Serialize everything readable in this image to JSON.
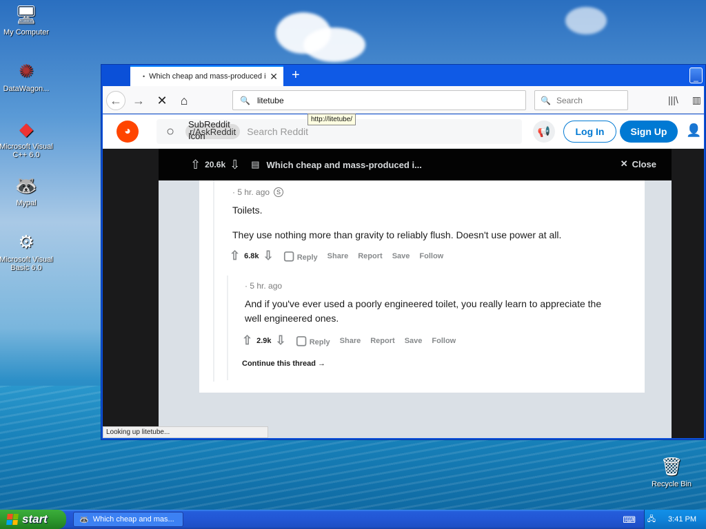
{
  "desktop": {
    "icons": [
      {
        "label": "My Computer",
        "icon": "computer-icon"
      },
      {
        "label": "DataWagon...",
        "icon": "datawagon-icon"
      },
      {
        "label": "Microsoft Visual C++ 6.0",
        "icon": "visual-cpp-icon"
      },
      {
        "label": "Mypal",
        "icon": "mypal-icon"
      },
      {
        "label": "Microsoft Visual Basic 6.0",
        "icon": "visual-basic-icon"
      },
      {
        "label": "Recycle Bin",
        "icon": "recycle-bin-icon"
      }
    ]
  },
  "taskbar": {
    "start_label": "start",
    "task_label": "Which cheap and mas...",
    "clock": "3:41 PM"
  },
  "browser": {
    "tab_title": "Which cheap and mass-produced i",
    "url": "litetube",
    "url_tooltip": "http://litetube/",
    "search_placeholder": "Search",
    "status_text": "Looking up litetube..."
  },
  "reddit": {
    "subreddit_chip": "r/AskReddit",
    "subreddit_alt_top": "SubReddit",
    "subreddit_alt_bottom": "Icon",
    "search_placeholder": "Search Reddit",
    "login_label": "Log In",
    "signup_label": "Sign Up",
    "post": {
      "score": "20.6k",
      "title": "Which cheap and mass-produced i...",
      "close_label": "Close"
    },
    "comments": [
      {
        "time": "· 5 hr. ago",
        "paragraphs": [
          "Toilets.",
          "They use nothing more than gravity to reliably flush. Doesn't use power at all."
        ],
        "score": "6.8k"
      },
      {
        "time": "· 5 hr. ago",
        "paragraphs": [
          "And if you've ever used a poorly engineered toilet, you really learn to appreciate the well engineered ones."
        ],
        "score": "2.9k"
      }
    ],
    "actions": {
      "reply": "Reply",
      "share": "Share",
      "report": "Report",
      "save": "Save",
      "follow": "Follow"
    },
    "continue_label": "Continue this thread"
  },
  "colors": {
    "reddit_orange": "#ff4500",
    "reddit_blue": "#0079d3",
    "xp_blue": "#0b50d8"
  }
}
